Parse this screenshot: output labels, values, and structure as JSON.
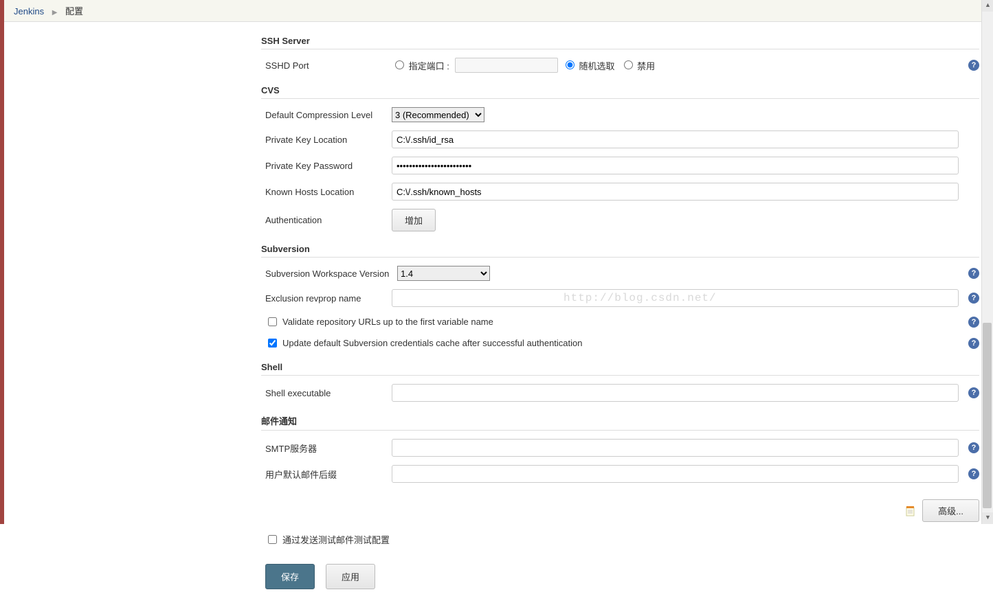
{
  "breadcrumb": {
    "root": "Jenkins",
    "current": "配置"
  },
  "ssh": {
    "section": "SSH Server",
    "port_label": "SSHD Port",
    "opt_specify": "指定端口 :",
    "opt_random": "随机选取",
    "opt_disable": "禁用"
  },
  "cvs": {
    "section": "CVS",
    "compression_label": "Default Compression Level",
    "compression_value": "3 (Recommended)",
    "pkloc_label": "Private Key Location",
    "pkloc_value": "C:\\/.ssh/id_rsa",
    "pkpass_label": "Private Key Password",
    "pkpass_value": "••••••••••••••••••••••••",
    "khosts_label": "Known Hosts Location",
    "khosts_value": "C:\\/.ssh/known_hosts",
    "auth_label": "Authentication",
    "add_btn": "增加"
  },
  "svn": {
    "section": "Subversion",
    "ws_label": "Subversion Workspace Version",
    "ws_value": "1.4",
    "excl_label": "Exclusion revprop name",
    "excl_value": "",
    "validate_label": "Validate repository URLs up to the first variable name",
    "update_label": "Update default Subversion credentials cache after successful authentication"
  },
  "shell": {
    "section": "Shell",
    "exec_label": "Shell executable",
    "exec_value": ""
  },
  "mail": {
    "section": "邮件通知",
    "smtp_label": "SMTP服务器",
    "smtp_value": "",
    "suffix_label": "用户默认邮件后缀",
    "suffix_value": "",
    "advanced_btn": "高级...",
    "test_label": "通过发送测试邮件测试配置"
  },
  "footer": {
    "save": "保存",
    "apply": "应用"
  },
  "watermark": "http://blog.csdn.net/"
}
